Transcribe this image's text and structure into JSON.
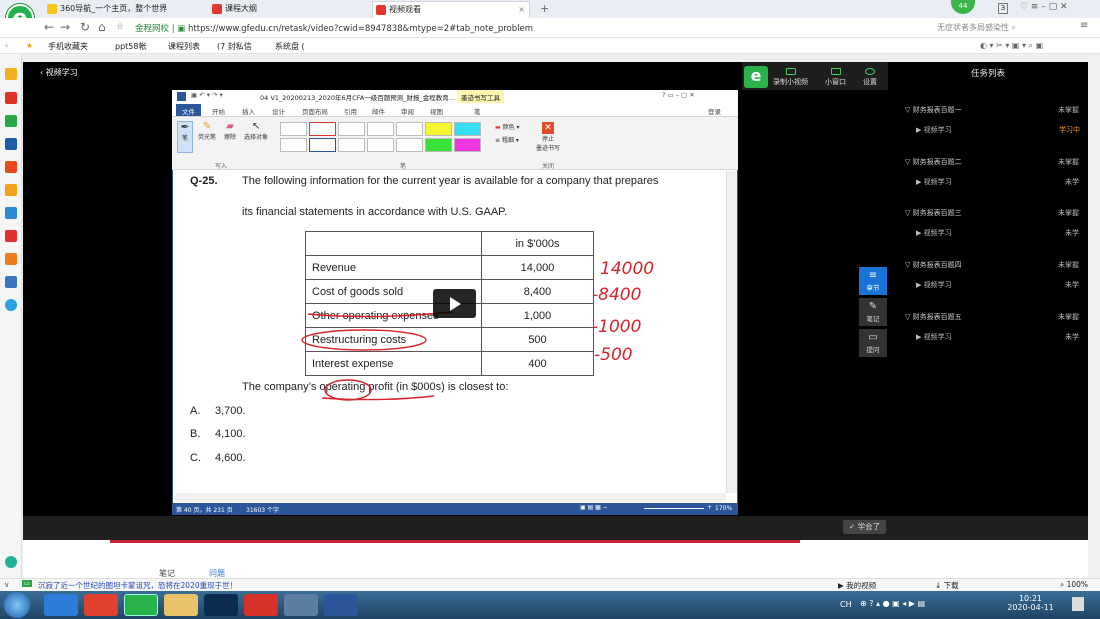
{
  "browser": {
    "tabs": [
      {
        "label": "360导航_一个主页，整个世界"
      },
      {
        "label": "课程大纲"
      },
      {
        "label": "视频观看"
      }
    ],
    "url_secure": "金程网校",
    "url": "https://www.gfedu.cn/retask/video?cwid=8947838&mtype=2#tab_note_problem",
    "search_hint": "无症状者多局感染性",
    "page_count": "3",
    "badge": "44",
    "bookmarks": [
      "手机收藏夹",
      "ppt58帐",
      "课程列表",
      "(7 封私信",
      "系统盘 ("
    ]
  },
  "player": {
    "back_label": "视频学习",
    "tools": [
      "录制小视频",
      "小窗口",
      "设置"
    ],
    "learned_button": "学会了",
    "side_buttons": [
      "章节",
      "笔记",
      "提问"
    ],
    "below_tabs": [
      "笔记",
      "问题"
    ]
  },
  "tasks": {
    "title": "任务列表",
    "chapters": [
      {
        "name": "财务报表百题一",
        "status": "未掌握",
        "video": "视频学习",
        "video_status": "学习中"
      },
      {
        "name": "财务报表百题二",
        "status": "未掌握",
        "video": "视频学习",
        "video_status": "未学"
      },
      {
        "name": "财务报表百题三",
        "status": "未掌握",
        "video": "视频学习",
        "video_status": "未学"
      },
      {
        "name": "财务报表百题四",
        "status": "未掌握",
        "video": "视频学习",
        "video_status": "未学"
      },
      {
        "name": "财务报表百题五",
        "status": "未掌握",
        "video": "视频学习",
        "video_status": "未学"
      }
    ],
    "current_color": "#f39b1a"
  },
  "word": {
    "title": "04 V1_20200213_2020年6月CFA一级百题预测_财报_金程教育...",
    "ink_tab": "墨迹书写工具",
    "tabs": [
      "文件",
      "开始",
      "插入",
      "设计",
      "页面布局",
      "引用",
      "邮件",
      "审阅",
      "视图",
      "笔"
    ],
    "login": "登录",
    "ribbon": {
      "pen": "笔",
      "highlighter": "荧光笔",
      "eraser": "擦除",
      "select": "选择对象",
      "color": "颜色",
      "thickness": "粗细",
      "stop": "停止\n墨迹书写",
      "groups": [
        "写入",
        "笔",
        "关闭"
      ]
    },
    "status_left": "第 40 页，共 231 页",
    "word_count": "31603 个字",
    "zoom": "170%"
  },
  "document": {
    "qnum": "Q-25.",
    "line1": "The following information for the current year is available for a company that prepares",
    "line2": "its financial statements in accordance with U.S. GAAP.",
    "table_header": "in $’000s",
    "rows": [
      {
        "label": "Revenue",
        "value": "14,000"
      },
      {
        "label": "Cost of goods sold",
        "value": "8,400"
      },
      {
        "label": "Other operating expenses",
        "value": "1,000"
      },
      {
        "label": "Restructuring costs",
        "value": "500"
      },
      {
        "label": "Interest expense",
        "value": "400"
      }
    ],
    "prompt": "The company’s operating profit (in $000s) is closest to:",
    "options": [
      {
        "letter": "A.",
        "text": "3,700."
      },
      {
        "letter": "B.",
        "text": "4,100."
      },
      {
        "letter": "C.",
        "text": "4,600."
      }
    ],
    "annotations": [
      "14000",
      "-8400",
      "-1000",
      "-500"
    ],
    "ink_color": "#d8232a"
  },
  "footer": {
    "news": "沉寂了近一个世纪的图坦卡蒙诅咒，恐将在2020重现于世！",
    "my_video": "我的视频",
    "download": "下载",
    "zoom": "100%"
  },
  "taskbar": {
    "time": "10:21",
    "date": "2020-04-11",
    "ime": "CH"
  }
}
